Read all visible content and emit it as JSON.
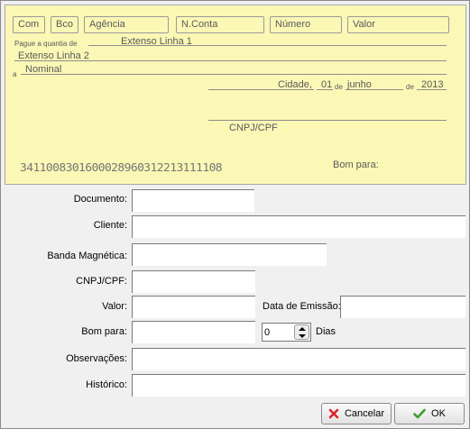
{
  "cheque": {
    "boxes": {
      "com": "Com",
      "bco": "Bco",
      "agencia": "Agência",
      "nconta": "N.Conta",
      "numero": "Número",
      "valor": "Valor"
    },
    "pague_prefix": "Pague a quantia de",
    "extenso_1": "Extenso Linha 1",
    "extenso_2": "Extenso Linha 2",
    "a_prefix": "a",
    "nominal": "Nominal",
    "cidade": "Cidade,",
    "dia": "01",
    "de_1": "de",
    "mes": "junho",
    "de_2": "de",
    "ano": "2013",
    "cnpj_cpf": "CNPJ/CPF",
    "micr": "3411008301600028960312213111108",
    "bom_para": "Bom para:"
  },
  "form": {
    "documento": {
      "label": "Documento:",
      "value": ""
    },
    "cliente": {
      "label": "Cliente:",
      "value": ""
    },
    "banda": {
      "label": "Banda Magnética:",
      "value": ""
    },
    "cnpj": {
      "label": "CNPJ/CPF:",
      "value": ""
    },
    "valor": {
      "label": "Valor:",
      "value": ""
    },
    "data_emissao": {
      "label": "Data de Emissão:",
      "value": ""
    },
    "bom_para": {
      "label": "Bom para:",
      "value": ""
    },
    "dias": {
      "value": "0",
      "label": "Dias"
    },
    "observacoes": {
      "label": "Observações:",
      "value": ""
    },
    "historico": {
      "label": "Histórico:",
      "value": ""
    }
  },
  "buttons": {
    "cancelar": "Cancelar",
    "ok": "OK"
  },
  "colors": {
    "cheque_bg": "#fbf7b5",
    "cancel_icon": "#d8262c",
    "ok_icon": "#3aa02c"
  }
}
